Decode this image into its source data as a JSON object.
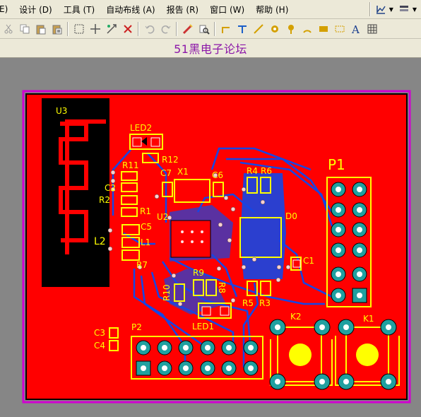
{
  "menu": {
    "items": [
      {
        "label": "E)"
      },
      {
        "label": "设计 (D)"
      },
      {
        "label": "工具 (T)"
      },
      {
        "label": "自动布线 (A)"
      },
      {
        "label": "报告 (R)"
      },
      {
        "label": "窗口 (W)"
      },
      {
        "label": "帮助 (H)"
      }
    ]
  },
  "document": {
    "title": "51黑电子论坛"
  },
  "pcb": {
    "labels": {
      "u3": "U3",
      "led2": "LED2",
      "r12": "R12",
      "r11": "R11",
      "c2": "C2",
      "r2": "R2",
      "r1": "R1",
      "c7": "C7",
      "x1": "X1",
      "c6": "C6",
      "r4": "R4",
      "r6": "R6",
      "p1": "P1",
      "u2": "U2",
      "c5": "C5",
      "l2": "L2",
      "l1": "L1",
      "r7": "R7",
      "d0": "D0",
      "c1": "C1",
      "r9": "R9",
      "r10": "R10",
      "r8": "R8",
      "r5": "R5",
      "r3": "R3",
      "led1": "LED1",
      "k2": "K2",
      "k1": "K1",
      "c3": "C3",
      "c4": "C4",
      "p2": "P2"
    },
    "colors": {
      "board": "#ff0000",
      "background": "#868686",
      "silkscreen": "#ffff00",
      "bottom_trace": "#1446e6",
      "outline": "#d000d0",
      "pad": "#20a0a0"
    }
  },
  "icons": [
    "cut-icon",
    "copy-icon",
    "paste-icon",
    "paste-special-icon",
    "select-icon",
    "move-icon",
    "cross-probe-icon",
    "clear-icon",
    "undo-icon",
    "redo-icon",
    "route-icon",
    "zoom-icon"
  ]
}
